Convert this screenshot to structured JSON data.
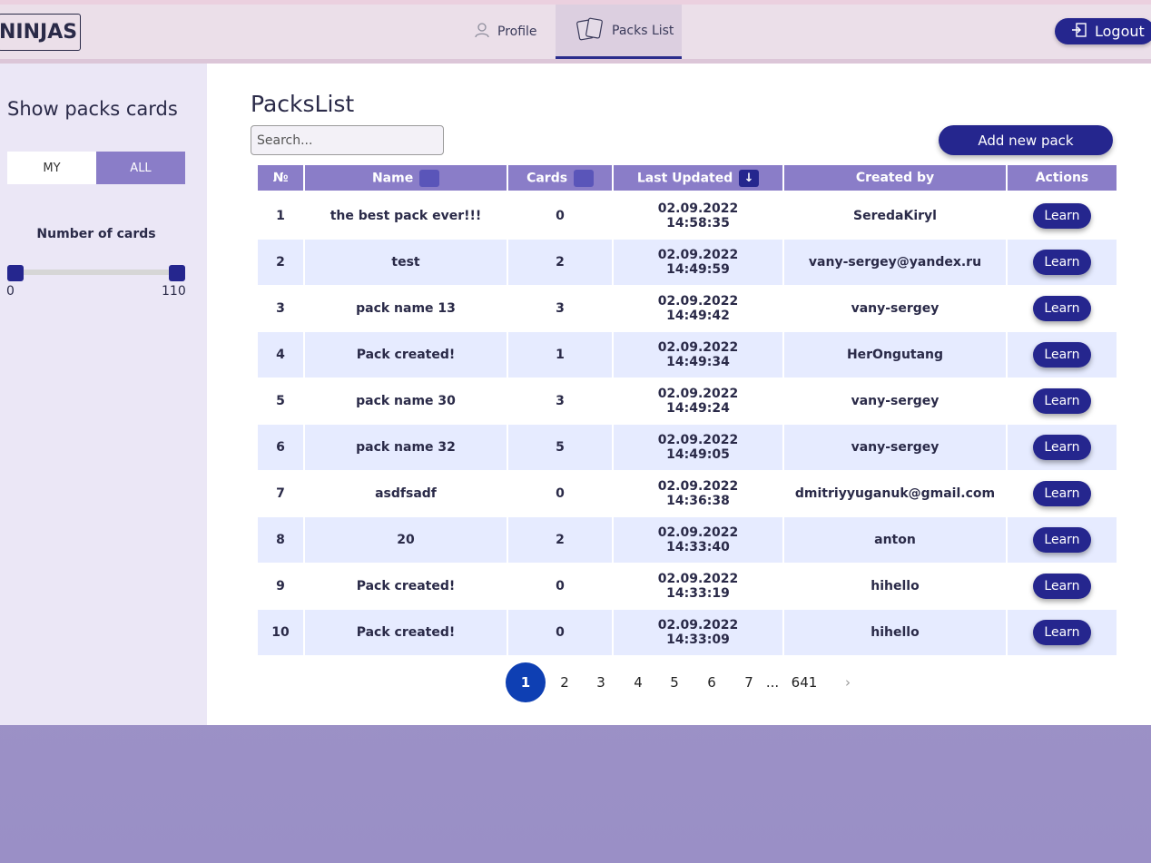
{
  "header": {
    "logo": "NINJAS",
    "nav": [
      {
        "label": "Profile"
      },
      {
        "label": "Packs List"
      }
    ],
    "logout_label": "Logout"
  },
  "sidebar": {
    "title": "Show packs cards",
    "toggle": {
      "my": "MY",
      "all": "ALL",
      "selected": "ALL"
    },
    "cards_label": "Number of cards",
    "range": {
      "min": "0",
      "max": "110"
    }
  },
  "main": {
    "title": "PacksList",
    "search_placeholder": "Search...",
    "add_button": "Add new pack",
    "columns": [
      "№",
      "Name",
      "Cards",
      "Last Updated",
      "Created by",
      "Actions"
    ],
    "sort_indicator": "↓",
    "learn_label": "Learn",
    "rows": [
      {
        "n": "1",
        "name": "the best pack ever!!!",
        "cards": "0",
        "date": "02.09.2022",
        "time": "14:58:35",
        "creator": "SeredaKiryl"
      },
      {
        "n": "2",
        "name": "test",
        "cards": "2",
        "date": "02.09.2022",
        "time": "14:49:59",
        "creator": "vany-sergey@yandex.ru"
      },
      {
        "n": "3",
        "name": "pack name 13",
        "cards": "3",
        "date": "02.09.2022",
        "time": "14:49:42",
        "creator": "vany-sergey"
      },
      {
        "n": "4",
        "name": "Pack created!",
        "cards": "1",
        "date": "02.09.2022",
        "time": "14:49:34",
        "creator": "HerOngutang"
      },
      {
        "n": "5",
        "name": "pack name 30",
        "cards": "3",
        "date": "02.09.2022",
        "time": "14:49:24",
        "creator": "vany-sergey"
      },
      {
        "n": "6",
        "name": "pack name 32",
        "cards": "5",
        "date": "02.09.2022",
        "time": "14:49:05",
        "creator": "vany-sergey"
      },
      {
        "n": "7",
        "name": "asdfsadf",
        "cards": "0",
        "date": "02.09.2022",
        "time": "14:36:38",
        "creator": "dmitriyyuganuk@gmail.com"
      },
      {
        "n": "8",
        "name": "20",
        "cards": "2",
        "date": "02.09.2022",
        "time": "14:33:40",
        "creator": "anton"
      },
      {
        "n": "9",
        "name": "Pack created!",
        "cards": "0",
        "date": "02.09.2022",
        "time": "14:33:19",
        "creator": "hihello"
      },
      {
        "n": "10",
        "name": "Pack created!",
        "cards": "0",
        "date": "02.09.2022",
        "time": "14:33:09",
        "creator": "hihello"
      }
    ],
    "pagination": {
      "current": "1",
      "pages": [
        "2",
        "3",
        "4",
        "5",
        "6",
        "7"
      ],
      "ellipsis": "...",
      "last": "641",
      "next": "›"
    }
  }
}
